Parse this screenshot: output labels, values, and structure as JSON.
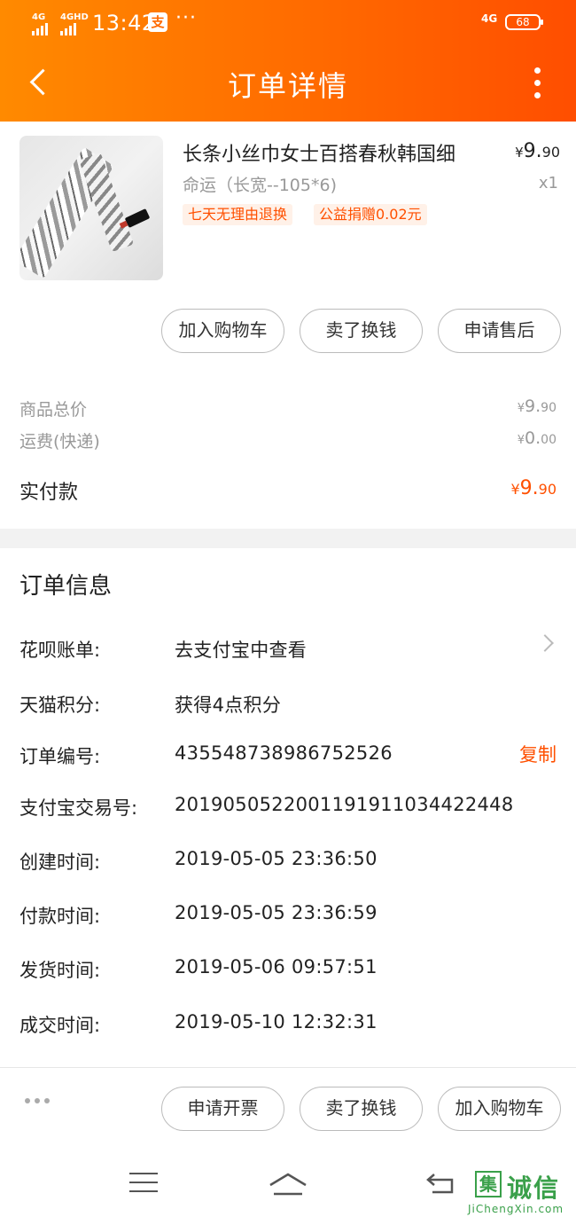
{
  "status_bar": {
    "sig1": "4G",
    "sig2": "4GHD",
    "time": "13:42",
    "alipay_glyph": "支",
    "more": "···",
    "net": "4G",
    "battery": "68"
  },
  "header": {
    "title": "订单详情",
    "back_icon": "chevron-left-icon",
    "more_icon": "vertical-dots-icon"
  },
  "product": {
    "name": "长条小丝巾女士百搭春秋韩国细",
    "spec": "命运（长宽--105*6)",
    "price_currency": "¥",
    "price_int": "9.",
    "price_dec": "90",
    "qty": "x1",
    "tags": [
      "七天无理由退换",
      "公益捐赠0.02元"
    ]
  },
  "actions_top": [
    "加入购物车",
    "卖了换钱",
    "申请售后"
  ],
  "summary": {
    "items": [
      {
        "label": "商品总价",
        "currency": "¥",
        "int": "9.",
        "dec": "90"
      },
      {
        "label": "运费(快递)",
        "currency": "¥",
        "int": "0.",
        "dec": "00"
      }
    ],
    "paid_label": "实付款",
    "paid_currency": "¥",
    "paid_int": "9.",
    "paid_dec": "90"
  },
  "order_info": {
    "title": "订单信息",
    "rows": [
      {
        "label": "花呗账单:",
        "value": "去支付宝中查看"
      },
      {
        "label": "天猫积分:",
        "value": "获得4点积分"
      },
      {
        "label": "订单编号:",
        "value": "435548738986752526"
      },
      {
        "label": "支付宝交易号:",
        "value": "2019050522001191911034422448"
      },
      {
        "label": "创建时间:",
        "value": "2019-05-05 23:36:50"
      },
      {
        "label": "付款时间:",
        "value": "2019-05-05 23:36:59"
      },
      {
        "label": "发货时间:",
        "value": "2019-05-06 09:57:51"
      },
      {
        "label": "成交时间:",
        "value": "2019-05-10 12:32:31"
      }
    ],
    "copy_label": "复制"
  },
  "actions_bottom": [
    "申请开票",
    "卖了换钱",
    "加入购物车"
  ],
  "watermark": {
    "box": "集",
    "text": "诚信",
    "sub": "JiChengXin.com"
  },
  "colors": {
    "accent": "#ff5000",
    "header_start": "#ff8a00",
    "header_end": "#ff4e00"
  }
}
